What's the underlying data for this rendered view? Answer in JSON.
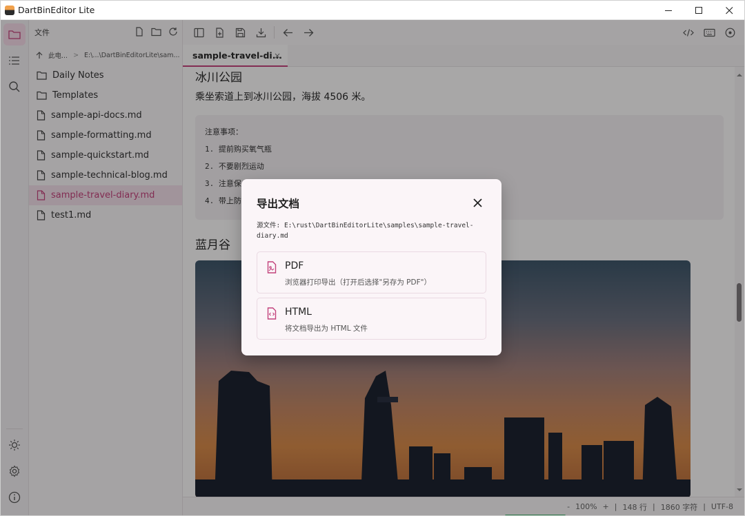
{
  "window": {
    "title": "DartBinEditor Lite"
  },
  "sidebar": {
    "header": "文件",
    "breadcrumb": [
      "此电...",
      ">",
      "E:\\...\\DartBinEditorLite\\sam..."
    ],
    "items": [
      {
        "label": "Daily Notes",
        "type": "folder"
      },
      {
        "label": "Templates",
        "type": "folder"
      },
      {
        "label": "sample-api-docs.md",
        "type": "file"
      },
      {
        "label": "sample-formatting.md",
        "type": "file"
      },
      {
        "label": "sample-quickstart.md",
        "type": "file"
      },
      {
        "label": "sample-technical-blog.md",
        "type": "file"
      },
      {
        "label": "sample-travel-diary.md",
        "type": "file",
        "active": true
      },
      {
        "label": "test1.md",
        "type": "file"
      }
    ]
  },
  "tab": {
    "label": "sample-travel-di...",
    "close": "×"
  },
  "editor": {
    "heading1": "冰川公园",
    "paragraph1": "乘坐索道上到冰川公园，海拔 4506 米。",
    "code_lines": [
      "注意事项：",
      "1. 提前购买氧气瓶",
      "2. 不要剧烈运动",
      "3. 注意保",
      "4. 带上防"
    ],
    "heading2": "蓝月谷"
  },
  "status": {
    "zoom_minus": "-",
    "zoom": "100%",
    "zoom_plus": "+",
    "sep1": "|",
    "lines": "148 行",
    "sep2": "|",
    "chars": "1860 字符",
    "sep3": "|",
    "encoding": "UTF-8"
  },
  "modal": {
    "title": "导出文档",
    "source": "源文件: E:\\rust\\DartBinEditorLite\\samples\\sample-travel-diary.md",
    "options": [
      {
        "title": "PDF",
        "subtitle": "浏览器打印导出（打开后选择\"另存为 PDF\"）",
        "icon": "pdf-file-icon"
      },
      {
        "title": "HTML",
        "subtitle": "将文档导出为 HTML 文件",
        "icon": "html-file-icon"
      }
    ]
  },
  "colors": {
    "accent": "#c2427b",
    "active_bg": "#f1dde7",
    "status_green": "#36b266"
  }
}
